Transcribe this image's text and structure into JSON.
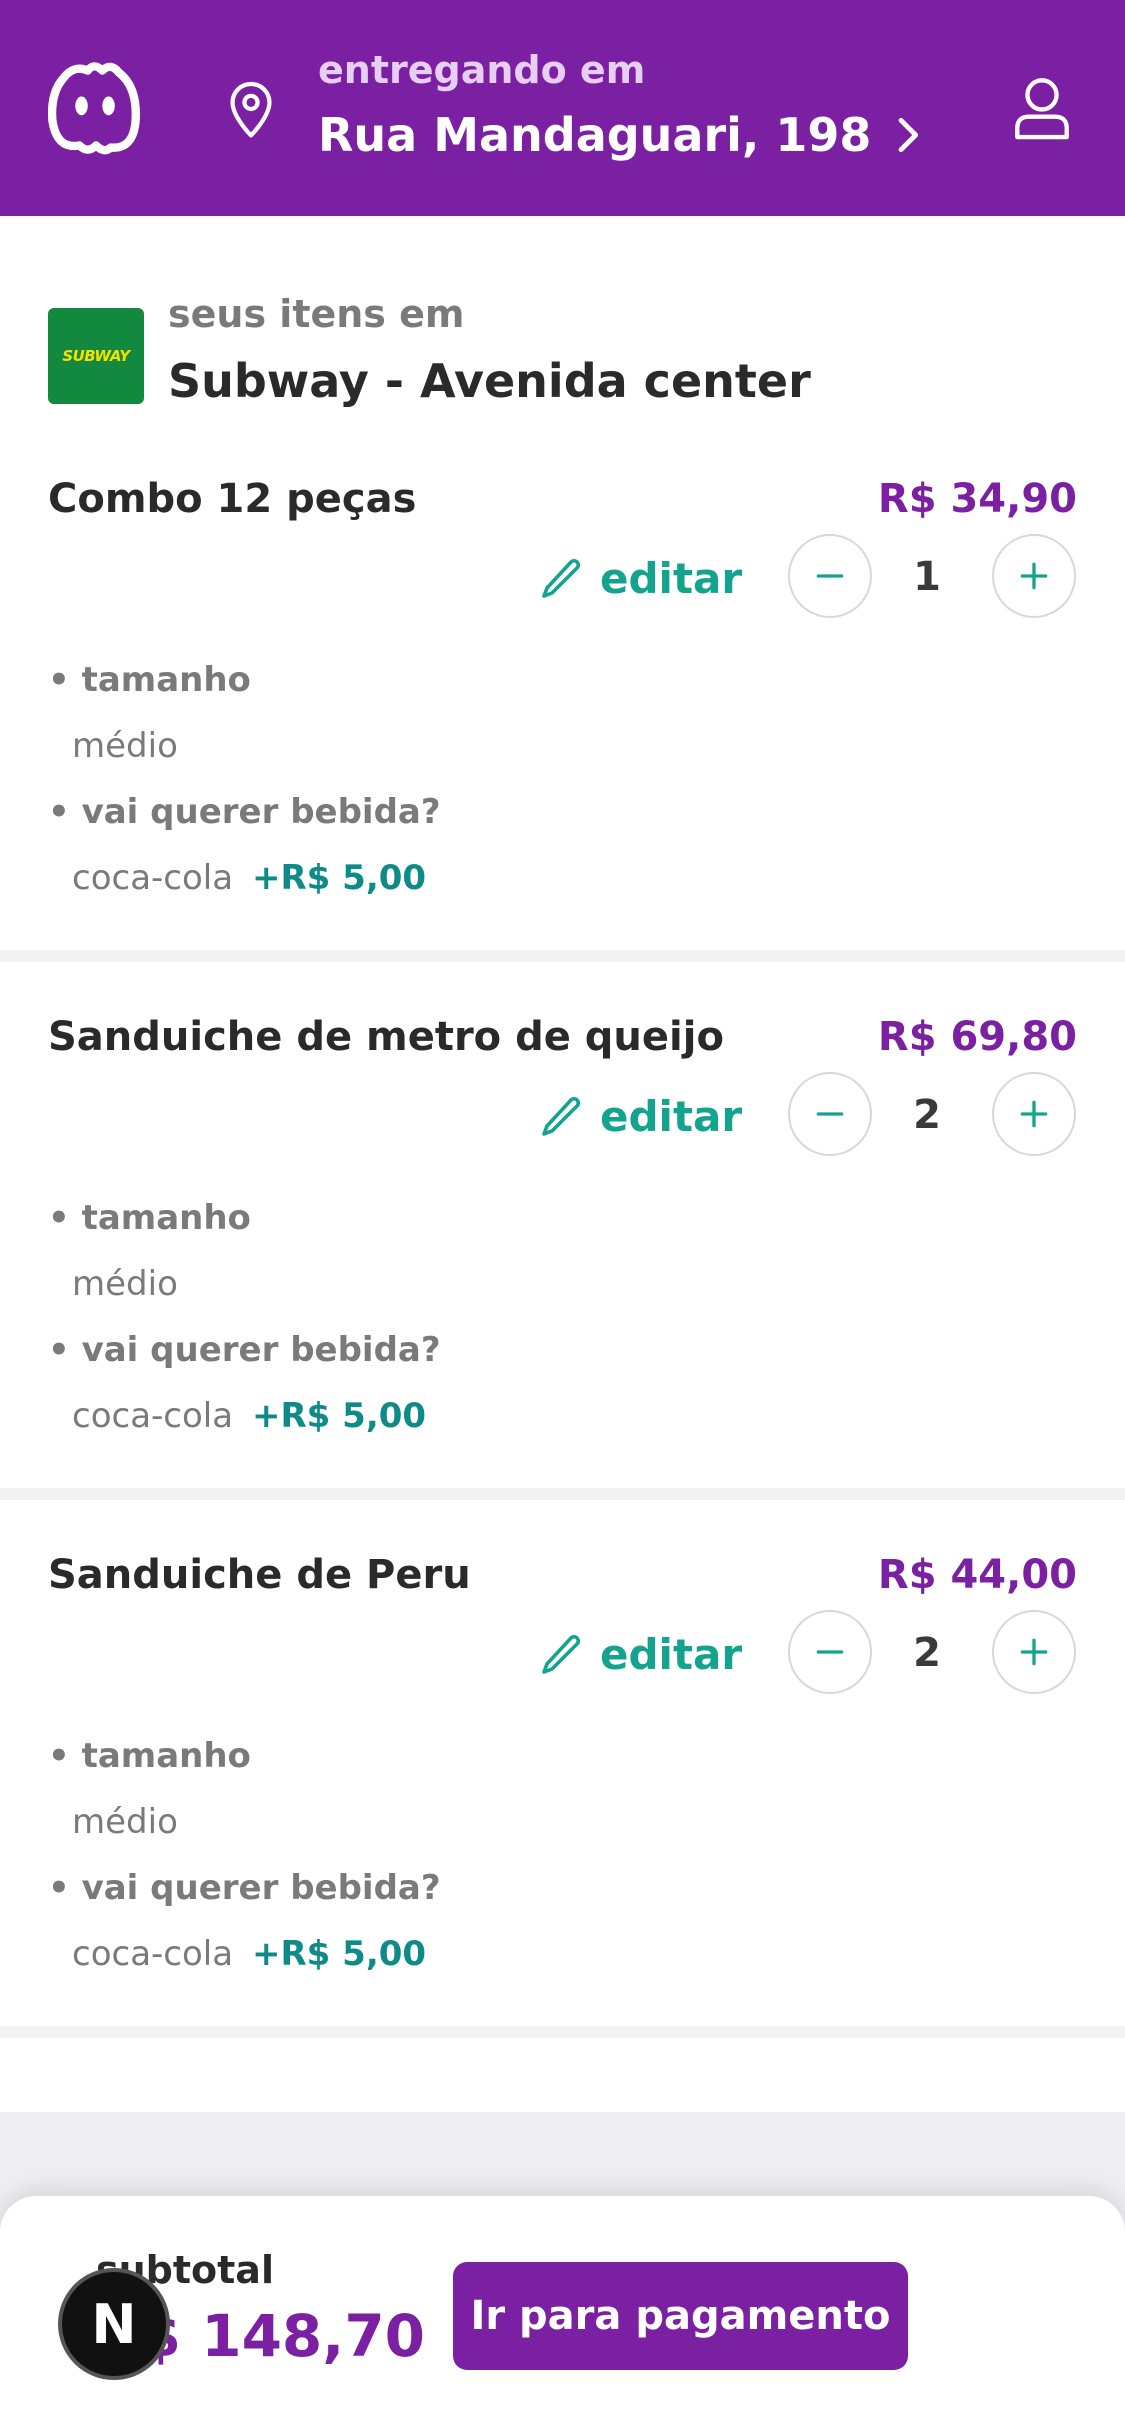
{
  "header": {
    "deliver_label": "entregando em",
    "address": "Rua Mandaguari, 198"
  },
  "store": {
    "logo_text": "SUBWAY",
    "subtitle": "seus itens em",
    "name": "Subway - Avenida center"
  },
  "items": [
    {
      "name": "Combo 12 peças",
      "price": "R$ 34,90",
      "edit_label": "editar",
      "quantity": "1",
      "options": [
        {
          "title": "• tamanho",
          "value": "médio",
          "extra": ""
        },
        {
          "title": "• vai querer bebida?",
          "value": "coca-cola",
          "extra": "+R$ 5,00"
        }
      ]
    },
    {
      "name": "Sanduiche de metro de queijo",
      "price": "R$ 69,80",
      "edit_label": "editar",
      "quantity": "2",
      "options": [
        {
          "title": "• tamanho",
          "value": "médio",
          "extra": ""
        },
        {
          "title": "• vai querer bebida?",
          "value": "coca-cola",
          "extra": "+R$ 5,00"
        }
      ]
    },
    {
      "name": "Sanduiche de Peru",
      "price": "R$ 44,00",
      "edit_label": "editar",
      "quantity": "2",
      "options": [
        {
          "title": "• tamanho",
          "value": "médio",
          "extra": ""
        },
        {
          "title": "• vai querer bebida?",
          "value": "coca-cola",
          "extra": "+R$ 5,00"
        }
      ]
    }
  ],
  "footer": {
    "subtotal_label": "subtotal",
    "subtotal_value": "R$ 148,70",
    "pay_button": "Ir para pagamento",
    "badge_letter": "N"
  },
  "colors": {
    "brand": "#7B20A3",
    "accent": "#14A38E",
    "extra_price": "#0E8A87"
  },
  "icons": [
    "mascot-logo-icon",
    "location-pin-icon",
    "chevron-right-icon",
    "user-icon",
    "pencil-icon",
    "minus-icon",
    "plus-icon"
  ]
}
